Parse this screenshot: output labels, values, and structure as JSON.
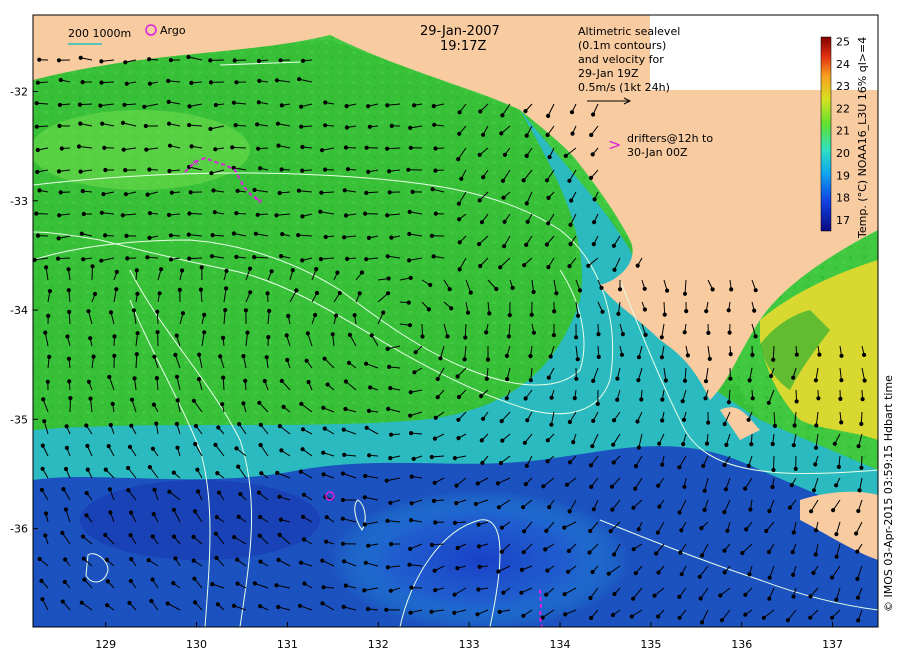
{
  "title": {
    "date": "29-Jan-2007",
    "time": "19:17Z"
  },
  "legend": {
    "bathy_label": "200  1000m",
    "argo_label": "Argo",
    "sealevel_lines": [
      "Altimetric sealevel",
      "(0.1m contours)",
      "and velocity for",
      "29-Jan 19Z",
      "0.5m/s (1kt 24h)"
    ],
    "drifters_lines": [
      "drifters@12h to",
      "30-Jan 00Z"
    ],
    "drifter_marker": ">"
  },
  "colorbar": {
    "label": "Temp. (°C) NOAA16_L3U 16% ql>=4",
    "ticks": [
      "17",
      "18",
      "19",
      "20",
      "21",
      "22",
      "23",
      "24",
      "25"
    ],
    "min": 16.5,
    "max": 25.2
  },
  "axes": {
    "x_ticks": [
      "129",
      "130",
      "131",
      "132",
      "133",
      "134",
      "135",
      "136",
      "137"
    ],
    "y_ticks": [
      "-32",
      "-33",
      "-34",
      "-35",
      "-36"
    ],
    "lon_range": [
      128.2,
      137.5
    ],
    "lat_range": [
      -36.9,
      -31.3
    ]
  },
  "credit": "© IMOS 03-Apr-2015 03:59:15 Hdbart time",
  "colors": {
    "land": "#f8cba0",
    "warm": "#e8e020",
    "mid": "#38c838",
    "cool": "#20a8e0",
    "cold": "#1030a0",
    "drifter": "#e020e0",
    "contour": "#e8ffe8"
  }
}
